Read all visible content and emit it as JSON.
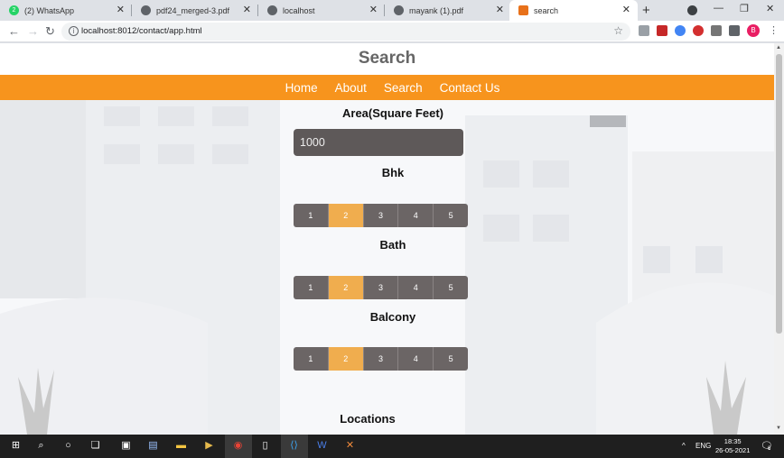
{
  "tabs": [
    {
      "label": "(2) WhatsApp",
      "badge": "2",
      "favicon_color": "#25d366"
    },
    {
      "label": "pdf24_merged-3.pdf",
      "favicon_color": "#5f6368"
    },
    {
      "label": "localhost",
      "favicon_color": "#5f6368"
    },
    {
      "label": "mayank (1).pdf",
      "favicon_color": "#5f6368"
    },
    {
      "label": "search",
      "favicon_color": "#e8711a"
    }
  ],
  "address_bar": {
    "url": "localhost:8012/contact/app.html"
  },
  "profile": {
    "initial": "B"
  },
  "page": {
    "title": "Search",
    "nav": [
      "Home",
      "About",
      "Search",
      "Contact Us"
    ],
    "area_label": "Area(Square Feet)",
    "area_value": "1000",
    "bhk_label": "Bhk",
    "bath_label": "Bath",
    "balcony_label": "Balcony",
    "locations_label": "Locations",
    "options": [
      "1",
      "2",
      "3",
      "4",
      "5"
    ],
    "bhk_selected": "2",
    "bath_selected": "2",
    "balcony_selected": "2"
  },
  "taskbar": {
    "lang": "ENG",
    "time": "18:35",
    "date": "26-05-2021",
    "notifications": "6"
  },
  "colors": {
    "accent": "#f7941d",
    "selected": "#f0ad4e",
    "segment": "#6b6565"
  }
}
